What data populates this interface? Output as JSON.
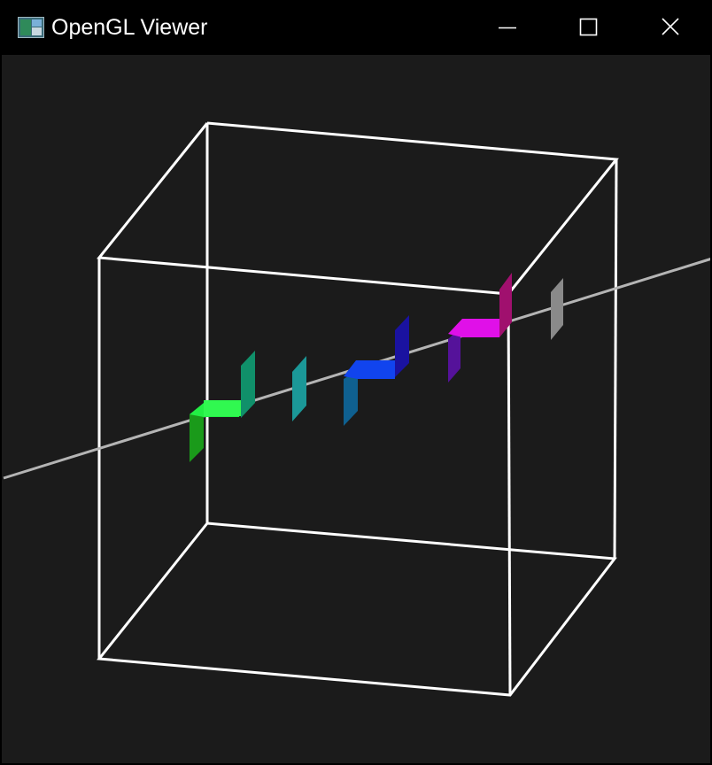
{
  "window": {
    "title": "OpenGL Viewer",
    "app_icon": "opengl-app-icon",
    "controls": {
      "minimize_icon": "minimize-icon",
      "maximize_icon": "maximize-icon",
      "close_icon": "close-icon"
    }
  },
  "scene": {
    "background_color": "#1b1b1b",
    "cube_edge_color": "#ffffff",
    "axis_line_color": "#b4b4b4",
    "markers": [
      {
        "name": "green-step-marker",
        "color": "#22ee44"
      },
      {
        "name": "teal-green-plane",
        "color": "#10906a"
      },
      {
        "name": "teal-plane",
        "color": "#1b9898"
      },
      {
        "name": "blue-step-marker",
        "color": "#1144ee"
      },
      {
        "name": "indigo-step-marker",
        "color": "#55129a"
      },
      {
        "name": "magenta-step-marker",
        "color": "#e010e8"
      },
      {
        "name": "gray-plane",
        "color": "#8a8a8a"
      }
    ]
  }
}
